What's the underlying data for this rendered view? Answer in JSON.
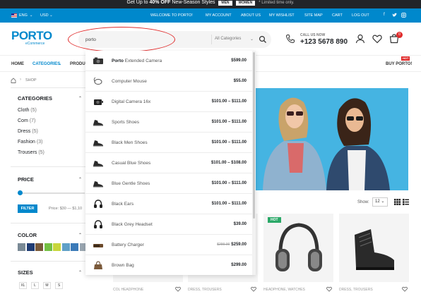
{
  "promo": {
    "lead": "Get Up to",
    "strong": "40% OFF",
    "rest": "New-Season Styles",
    "btn_men": "MEN",
    "btn_women": "WOMEN",
    "note": "* Limited time only."
  },
  "topbar": {
    "language": "ENG",
    "currency": "USD",
    "links": [
      "WELCOME TO PORTO!",
      "MY ACCOUNT",
      "ABOUT US",
      "MY WISHLIST",
      "SITE MAP",
      "CART",
      "LOG OUT"
    ],
    "social": [
      "f",
      "t",
      "ig"
    ]
  },
  "header": {
    "logo": "PORTO",
    "logo_sub": "eCommerce",
    "search_value": "porto",
    "search_category": "All Categories",
    "call_label": "CALL US NOW",
    "phone": "+123 5678 890",
    "cart_count": "0"
  },
  "nav": {
    "items": [
      "HOME",
      "CATEGORIES",
      "PRODUC"
    ],
    "promo_link": "BUY PORTO!",
    "hot": "HOT"
  },
  "breadcrumb": {
    "current": "SHOP"
  },
  "sidebar": {
    "categories_title": "CATEGORIES",
    "categories": [
      {
        "name": "Cloth",
        "count": "(5)"
      },
      {
        "name": "Com",
        "count": "(7)"
      },
      {
        "name": "Dress",
        "count": "(5)"
      },
      {
        "name": "Fashion",
        "count": "(3)"
      },
      {
        "name": "Trousers",
        "count": "(5)"
      }
    ],
    "price_title": "PRICE",
    "filter_label": "FILTER",
    "price_range": "Price: $30 — $1,10",
    "color_title": "COLOR",
    "colors": [
      "#7a8a96",
      "#1f3c74",
      "#7a5a3a",
      "#74c043",
      "#c8d63c",
      "#5fa0c8",
      "#3b7ab8",
      "#9aa6b0"
    ],
    "sizes_title": "SIZES",
    "sizes": [
      "XL",
      "L",
      "M",
      "S"
    ]
  },
  "search_results": [
    {
      "strong": "Porto",
      "rest": " Extended Camera",
      "price": "$599.00",
      "old": "",
      "icon": "camera-icon"
    },
    {
      "strong": "",
      "rest": "Computer Mouse",
      "price": "$55.00",
      "old": "",
      "icon": "mouse-icon"
    },
    {
      "strong": "",
      "rest": "Digital Camera 16x",
      "price": "$101.00 – $111.00",
      "old": "",
      "icon": "digital-camera-icon"
    },
    {
      "strong": "",
      "rest": "Sports Shoes",
      "price": "$101.00 – $111.00",
      "old": "",
      "icon": "shoe-icon"
    },
    {
      "strong": "",
      "rest": "Black Men Shoes",
      "price": "$101.00 – $111.00",
      "old": "",
      "icon": "shoe-icon"
    },
    {
      "strong": "",
      "rest": "Casual Blue Shoes",
      "price": "$101.00 – $108.00",
      "old": "",
      "icon": "shoe-icon"
    },
    {
      "strong": "",
      "rest": "Blue Gentle Shoes",
      "price": "$101.00 – $111.00",
      "old": "",
      "icon": "shoe-icon"
    },
    {
      "strong": "",
      "rest": "Black Ears",
      "price": "$101.00 – $111.00",
      "old": "",
      "icon": "headphones-icon"
    },
    {
      "strong": "",
      "rest": "Black Grey Headset",
      "price": "$39.00",
      "old": "",
      "icon": "headphones-icon"
    },
    {
      "strong": "",
      "rest": "Battery Charger",
      "price": "$259.00",
      "old": "$299.00",
      "icon": "charger-icon"
    },
    {
      "strong": "",
      "rest": "Brown Bag",
      "price": "$299.00",
      "old": "",
      "icon": "bag-icon"
    }
  ],
  "toolbar": {
    "show_label": "Show:",
    "show_value": "12"
  },
  "products": [
    {
      "category": "COL HEADPHONE",
      "hot": ""
    },
    {
      "category": "DRESS, TROUSERS",
      "hot": ""
    },
    {
      "category": "HEADPHONE, WATCHES",
      "hot": "HOT"
    },
    {
      "category": "DRESS, TROUSERS",
      "hot": ""
    }
  ]
}
